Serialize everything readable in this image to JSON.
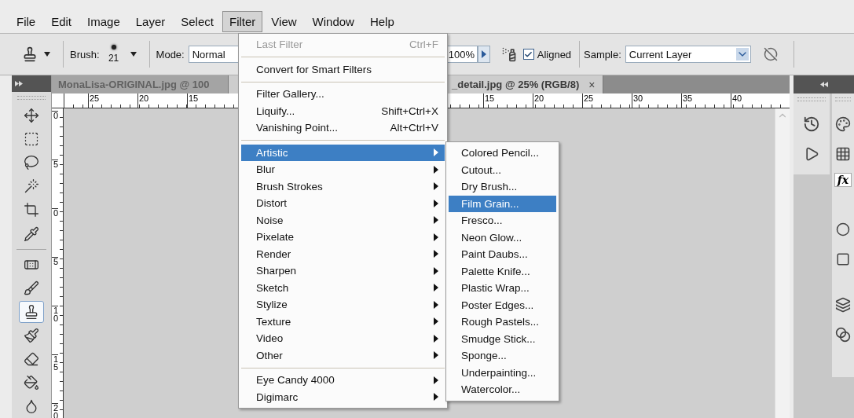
{
  "menu_bar": [
    {
      "label": "File",
      "selected": false
    },
    {
      "label": "Edit",
      "selected": false
    },
    {
      "label": "Image",
      "selected": false
    },
    {
      "label": "Layer",
      "selected": false
    },
    {
      "label": "Select",
      "selected": false
    },
    {
      "label": "Filter",
      "selected": true
    },
    {
      "label": "View",
      "selected": false
    },
    {
      "label": "Window",
      "selected": false
    },
    {
      "label": "Help",
      "selected": false
    }
  ],
  "options_bar": {
    "brush_label": "Brush:",
    "brush_size": "21",
    "mode_label": "Mode:",
    "mode_value": "Normal",
    "flow_value": "100%",
    "aligned": {
      "label": "Aligned",
      "checked": true
    },
    "sample_label": "Sample:",
    "sample_value": "Current Layer"
  },
  "tool_groups": [
    {
      "tools": [
        {
          "kind": "move",
          "selected": false
        },
        {
          "kind": "marquee",
          "selected": false
        },
        {
          "kind": "lasso",
          "selected": false
        },
        {
          "kind": "wand",
          "selected": false
        },
        {
          "kind": "crop",
          "selected": false
        },
        {
          "kind": "eyedropper",
          "selected": false
        }
      ]
    },
    {
      "tools": [
        {
          "kind": "healing",
          "selected": false
        },
        {
          "kind": "brush",
          "selected": false
        },
        {
          "kind": "stamp",
          "selected": true
        },
        {
          "kind": "history_brush",
          "selected": false
        },
        {
          "kind": "eraser",
          "selected": false
        },
        {
          "kind": "bucket",
          "selected": false
        },
        {
          "kind": "blur",
          "selected": false
        }
      ]
    }
  ],
  "document_tabs": [
    {
      "title": "MonaLisa-ORIGINAL.jpg @ 100",
      "selected": false
    },
    {
      "title": "_detail.jpg @ 25% (RGB/8)",
      "selected": true,
      "close": "×"
    }
  ],
  "horizontal_ruler": {
    "left_labels": [
      "25",
      "20",
      "15"
    ],
    "right_labels": [
      "15",
      "20",
      "25",
      "30",
      "35",
      "40"
    ]
  },
  "vertical_ruler": [
    "0",
    "5",
    "0",
    "5",
    "10",
    "15",
    "20"
  ],
  "right_dock": {
    "styles_label": "fx"
  },
  "filter_menu": [
    {
      "kind": "command",
      "label": "Last Filter",
      "shortcut": "Ctrl+F",
      "disabled": true,
      "selected": false
    },
    {
      "kind": "separator"
    },
    {
      "kind": "command",
      "label": "Convert for Smart Filters",
      "disabled": false,
      "selected": false
    },
    {
      "kind": "separator"
    },
    {
      "kind": "command",
      "label": "Filter Gallery...",
      "disabled": false,
      "selected": false
    },
    {
      "kind": "command",
      "label": "Liquify...",
      "shortcut": "Shift+Ctrl+X",
      "disabled": false,
      "selected": false
    },
    {
      "kind": "command",
      "label": "Vanishing Point...",
      "shortcut": "Alt+Ctrl+V",
      "disabled": false,
      "selected": false
    },
    {
      "kind": "separator"
    },
    {
      "kind": "submenu",
      "label": "Artistic",
      "disabled": false,
      "selected": true
    },
    {
      "kind": "submenu",
      "label": "Blur",
      "disabled": false,
      "selected": false
    },
    {
      "kind": "submenu",
      "label": "Brush Strokes",
      "disabled": false,
      "selected": false
    },
    {
      "kind": "submenu",
      "label": "Distort",
      "disabled": false,
      "selected": false
    },
    {
      "kind": "submenu",
      "label": "Noise",
      "disabled": false,
      "selected": false
    },
    {
      "kind": "submenu",
      "label": "Pixelate",
      "disabled": false,
      "selected": false
    },
    {
      "kind": "submenu",
      "label": "Render",
      "disabled": false,
      "selected": false
    },
    {
      "kind": "submenu",
      "label": "Sharpen",
      "disabled": false,
      "selected": false
    },
    {
      "kind": "submenu",
      "label": "Sketch",
      "disabled": false,
      "selected": false
    },
    {
      "kind": "submenu",
      "label": "Stylize",
      "disabled": false,
      "selected": false
    },
    {
      "kind": "submenu",
      "label": "Texture",
      "disabled": false,
      "selected": false
    },
    {
      "kind": "submenu",
      "label": "Video",
      "disabled": false,
      "selected": false
    },
    {
      "kind": "submenu",
      "label": "Other",
      "disabled": false,
      "selected": false
    },
    {
      "kind": "separator"
    },
    {
      "kind": "submenu",
      "label": "Eye Candy 4000",
      "disabled": false,
      "selected": false
    },
    {
      "kind": "submenu",
      "label": "Digimarc",
      "disabled": false,
      "selected": false
    }
  ],
  "artistic_submenu": [
    {
      "label": "Colored Pencil...",
      "selected": false
    },
    {
      "label": "Cutout...",
      "selected": false
    },
    {
      "label": "Dry Brush...",
      "selected": false
    },
    {
      "label": "Film Grain...",
      "selected": true
    },
    {
      "label": "Fresco...",
      "selected": false
    },
    {
      "label": "Neon Glow...",
      "selected": false
    },
    {
      "label": "Paint Daubs...",
      "selected": false
    },
    {
      "label": "Palette Knife...",
      "selected": false
    },
    {
      "label": "Plastic Wrap...",
      "selected": false
    },
    {
      "label": "Poster Edges...",
      "selected": false
    },
    {
      "label": "Rough Pastels...",
      "selected": false
    },
    {
      "label": "Smudge Stick...",
      "selected": false
    },
    {
      "label": "Sponge...",
      "selected": false
    },
    {
      "label": "Underpainting...",
      "selected": false
    },
    {
      "label": "Watercolor...",
      "selected": false
    }
  ]
}
